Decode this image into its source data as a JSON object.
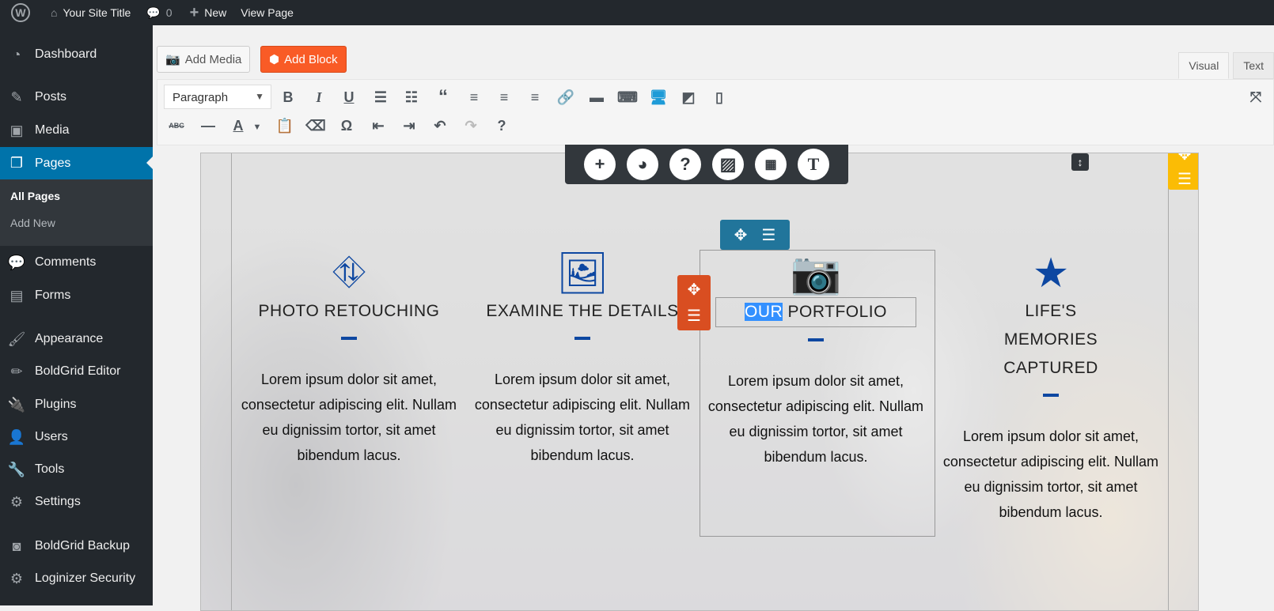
{
  "adminbar": {
    "site_title": "Your Site Title",
    "comments": "0",
    "new": "New",
    "view": "View Page"
  },
  "sidebar": {
    "items": [
      "Dashboard",
      "Posts",
      "Media",
      "Pages",
      "Comments",
      "Forms",
      "Appearance",
      "BoldGrid Editor",
      "Plugins",
      "Users",
      "Tools",
      "Settings",
      "BoldGrid Backup",
      "Loginizer Security"
    ],
    "sub": [
      "All Pages",
      "Add New"
    ],
    "active": "Pages"
  },
  "editor": {
    "add_media": "Add Media",
    "add_block": "Add Block",
    "tab_visual": "Visual",
    "tab_text": "Text",
    "format": "Paragraph",
    "accent": "#f95b26"
  },
  "columns": [
    {
      "title": "PHOTO RETOUCHING",
      "icon": "binoculars-icon",
      "text": "Lorem ipsum dolor sit amet, consectetur adipiscing elit. Nullam eu dignissim tortor, sit amet bibendum lacus."
    },
    {
      "title": "EXAMINE THE DETAILS",
      "icon": "image-icon",
      "text": "Lorem ipsum dolor sit amet, consectetur adipiscing elit. Nullam eu dignissim tortor, sit amet bibendum lacus."
    },
    {
      "title_sel": "OUR",
      "title_rest": " PORTFOLIO",
      "icon": "camera-icon",
      "text": "Lorem ipsum dolor sit amet, consectetur adipiscing elit. Nullam eu dignissim tortor, sit amet bibendum lacus."
    },
    {
      "title": "LIFE'S MEMORIES CAPTURED",
      "icon": "star-icon",
      "text": "Lorem ipsum dolor sit amet, consectetur adipiscing elit. Nullam eu dignissim tortor, sit amet bibendum lacus."
    }
  ]
}
